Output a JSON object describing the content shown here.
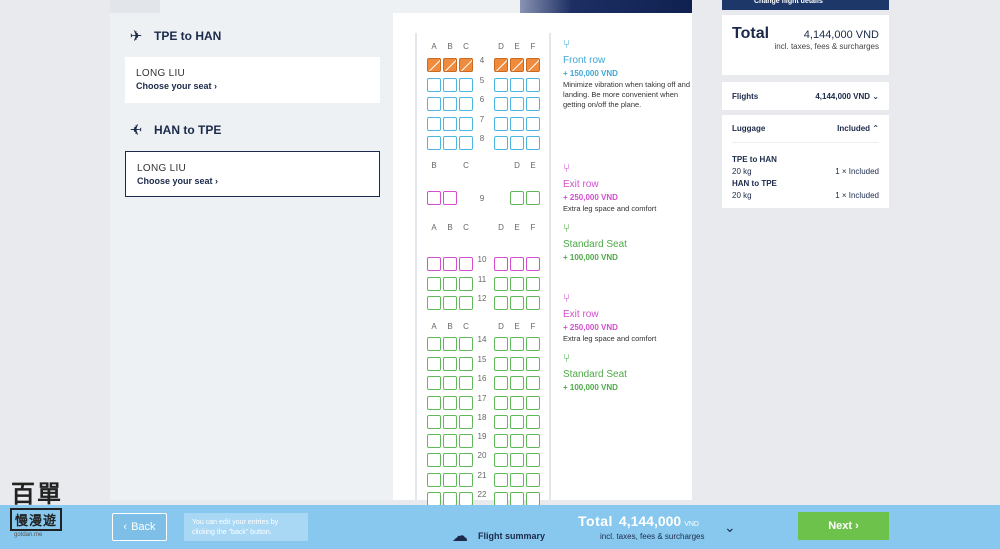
{
  "top": {
    "change_flight_label": "Change flight details"
  },
  "passengers": {
    "flight1": {
      "route": "TPE to HAN",
      "name": "LONG LIU",
      "choose": "Choose your seat"
    },
    "flight2": {
      "route": "HAN to TPE",
      "name": "LONG LIU",
      "choose": "Choose your seat"
    }
  },
  "seatmap": {
    "sections": [
      {
        "letters_left": [
          "A",
          "B",
          "C"
        ],
        "letters_right": [
          "D",
          "E",
          "F"
        ],
        "rows": [
          {
            "no": "4",
            "type": "front",
            "taken": [
              true,
              true,
              true,
              true,
              true,
              true
            ]
          },
          {
            "no": "5",
            "type": "front"
          },
          {
            "no": "6",
            "type": "front"
          },
          {
            "no": "7",
            "type": "front"
          },
          {
            "no": "8",
            "type": "front"
          }
        ]
      },
      {
        "letters_left": [
          "B",
          "C"
        ],
        "letters_right": [
          "D",
          "E"
        ],
        "rows": [
          {
            "no": "9",
            "type": "exit-std"
          }
        ]
      },
      {
        "letters_left": [
          "A",
          "B",
          "C"
        ],
        "letters_right": [
          "D",
          "E",
          "F"
        ],
        "rows": [
          {
            "no": "10",
            "type": "exit"
          },
          {
            "no": "11",
            "type": "std"
          },
          {
            "no": "12",
            "type": "std"
          }
        ]
      },
      {
        "letters_left": [
          "A",
          "B",
          "C"
        ],
        "letters_right": [
          "D",
          "E",
          "F"
        ],
        "rows": [
          {
            "no": "14",
            "type": "std"
          },
          {
            "no": "15",
            "type": "std"
          },
          {
            "no": "16",
            "type": "std"
          },
          {
            "no": "17",
            "type": "std"
          },
          {
            "no": "18",
            "type": "std"
          },
          {
            "no": "19",
            "type": "std"
          },
          {
            "no": "20",
            "type": "std"
          },
          {
            "no": "21",
            "type": "std"
          },
          {
            "no": "22",
            "type": "std"
          }
        ]
      }
    ]
  },
  "legend": [
    {
      "name": "Front row",
      "price": "+ 150,000 VND",
      "desc": "Minimize vibration when taking off and landing. Be more convenient when getting on/off the plane.",
      "kind": "front"
    },
    {
      "name": "Exit row",
      "price": "+ 250,000 VND",
      "desc": "Extra leg space and comfort",
      "kind": "exit"
    },
    {
      "name": "Standard Seat",
      "price": "+ 100,000 VND",
      "desc": "",
      "kind": "std"
    },
    {
      "name": "Exit row",
      "price": "+ 250,000 VND",
      "desc": "Extra leg space and comfort",
      "kind": "exit"
    },
    {
      "name": "Standard Seat",
      "price": "+ 100,000 VND",
      "desc": "",
      "kind": "std"
    }
  ],
  "summary": {
    "total_label": "Total",
    "total_value": "4,144,000 VND",
    "total_incl": "incl. taxes, fees & surcharges",
    "flights_label": "Flights",
    "flights_value": "4,144,000 VND",
    "luggage_label": "Luggage",
    "luggage_value": "Included",
    "luggage_items": [
      {
        "route": "TPE to HAN",
        "weight": "20 kg",
        "status": "1 × Included"
      },
      {
        "route": "HAN to TPE",
        "weight": "20 kg",
        "status": "1 × Included"
      }
    ]
  },
  "bottom": {
    "back_label": "Back",
    "hint": "You can edit your entries by clicking the \"back\" button.",
    "flight_summary": "Flight summary",
    "total_label": "Total",
    "total_value": "4,144,000",
    "total_unit": "VND",
    "total_incl": "incl. taxes, fees & surcharges",
    "next_label": "Next"
  },
  "logo": {
    "line1": "百單",
    "line2": "慢漫遊",
    "line3": "gotdan.me"
  },
  "colors": {
    "navy": "#1b2a4a",
    "front": "#4cb6e0",
    "exit": "#d34fd0",
    "std": "#61b85a",
    "taken": "#f08a3c",
    "next": "#6cc24a",
    "bar": "#88c8ef"
  }
}
